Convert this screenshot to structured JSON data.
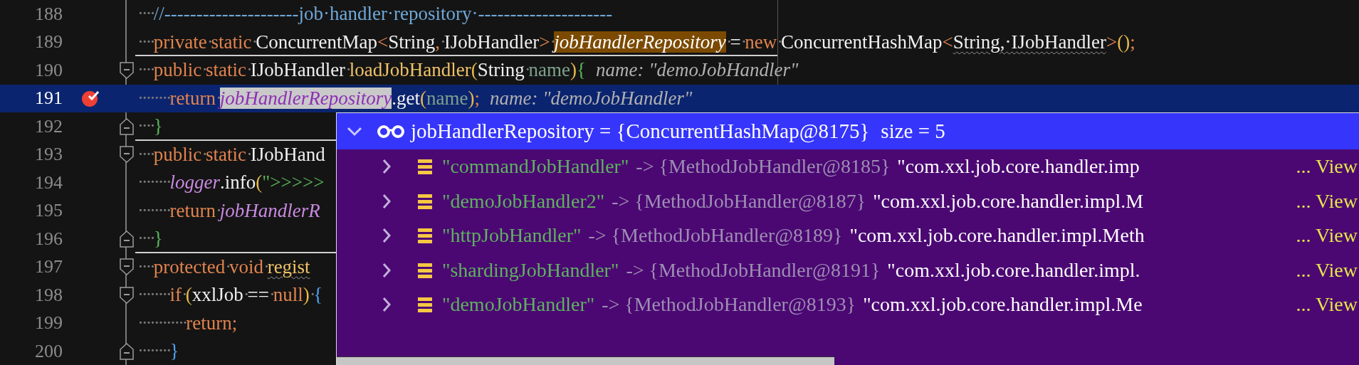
{
  "editor": {
    "lines": [
      {
        "number": "188",
        "current": false,
        "breakpoint": false,
        "fold_start": false,
        "fold_end": false,
        "separator": false,
        "tokens": [
          {
            "text": "····",
            "kind": "ws"
          },
          {
            "text": "//---------------------job·handler·repository·---------------------",
            "kind": "comment"
          }
        ]
      },
      {
        "number": "189",
        "current": false,
        "breakpoint": false,
        "fold_start": false,
        "fold_end": false,
        "separator": true,
        "tokens": [
          {
            "text": "····",
            "kind": "ws"
          },
          {
            "text": "private",
            "kind": "kw"
          },
          {
            "text": "·",
            "kind": "ws"
          },
          {
            "text": "static",
            "kind": "kw"
          },
          {
            "text": "·",
            "kind": "ws"
          },
          {
            "text": "ConcurrentMap",
            "kind": "plain"
          },
          {
            "text": "<",
            "kind": "op"
          },
          {
            "text": "String",
            "kind": "plain"
          },
          {
            "text": ",",
            "kind": "op"
          },
          {
            "text": "·",
            "kind": "ws"
          },
          {
            "text": "IJobHandler",
            "kind": "plain"
          },
          {
            "text": ">",
            "kind": "op"
          },
          {
            "text": "·",
            "kind": "ws"
          },
          {
            "text": "jobHandlerRepository",
            "kind": "fieldhl"
          },
          {
            "text": "·",
            "kind": "ws"
          },
          {
            "text": "=",
            "kind": "plain"
          },
          {
            "text": "·",
            "kind": "ws"
          },
          {
            "text": "new",
            "kind": "kw"
          },
          {
            "text": "·",
            "kind": "ws"
          },
          {
            "text": "ConcurrentHashMap",
            "kind": "plain"
          },
          {
            "text": "<",
            "kind": "op"
          },
          {
            "text": "String,·IJobHandler",
            "kind": "warn"
          },
          {
            "text": ">",
            "kind": "op"
          },
          {
            "text": "()",
            "kind": "paren"
          },
          {
            "text": ";",
            "kind": "op"
          }
        ]
      },
      {
        "number": "190",
        "current": false,
        "breakpoint": false,
        "fold_start": true,
        "fold_end": false,
        "separator": false,
        "tokens": [
          {
            "text": "····",
            "kind": "ws"
          },
          {
            "text": "public",
            "kind": "kw"
          },
          {
            "text": "·",
            "kind": "ws"
          },
          {
            "text": "static",
            "kind": "kw"
          },
          {
            "text": "·",
            "kind": "ws"
          },
          {
            "text": "IJobHandler",
            "kind": "plain"
          },
          {
            "text": "·",
            "kind": "ws"
          },
          {
            "text": "loadJobHandler",
            "kind": "method"
          },
          {
            "text": "(",
            "kind": "paren"
          },
          {
            "text": "String",
            "kind": "plain"
          },
          {
            "text": "·",
            "kind": "ws"
          },
          {
            "text": "name",
            "kind": "param"
          },
          {
            "text": ")",
            "kind": "paren"
          },
          {
            "text": "{",
            "kind": "brace"
          }
        ],
        "hint": "name: \"demoJobHandler\""
      },
      {
        "number": "191",
        "current": true,
        "breakpoint": true,
        "fold_start": false,
        "fold_end": false,
        "separator": false,
        "tokens": [
          {
            "text": "········",
            "kind": "ws"
          },
          {
            "text": "return",
            "kind": "kw"
          },
          {
            "text": "·",
            "kind": "ws"
          },
          {
            "text": "jobHandlerRepository",
            "kind": "fieldsel"
          },
          {
            "text": ".get",
            "kind": "plain"
          },
          {
            "text": "(",
            "kind": "paren"
          },
          {
            "text": "name",
            "kind": "param"
          },
          {
            "text": ")",
            "kind": "paren"
          },
          {
            "text": ";",
            "kind": "op"
          }
        ],
        "hint": "name: \"demoJobHandler\""
      },
      {
        "number": "192",
        "current": false,
        "breakpoint": false,
        "fold_start": false,
        "fold_end": true,
        "separator": true,
        "tokens": [
          {
            "text": "····",
            "kind": "ws"
          },
          {
            "text": "}",
            "kind": "brace"
          }
        ]
      },
      {
        "number": "193",
        "current": false,
        "breakpoint": false,
        "fold_start": true,
        "fold_end": false,
        "separator": false,
        "tokens": [
          {
            "text": "····",
            "kind": "ws"
          },
          {
            "text": "public",
            "kind": "kw"
          },
          {
            "text": "·",
            "kind": "ws"
          },
          {
            "text": "static",
            "kind": "kw"
          },
          {
            "text": "·",
            "kind": "ws"
          },
          {
            "text": "IJobHand",
            "kind": "plain"
          }
        ]
      },
      {
        "number": "194",
        "current": false,
        "breakpoint": false,
        "fold_start": false,
        "fold_end": false,
        "separator": false,
        "tokens": [
          {
            "text": "········",
            "kind": "ws"
          },
          {
            "text": "logger",
            "kind": "field"
          },
          {
            "text": ".info",
            "kind": "plain"
          },
          {
            "text": "(",
            "kind": "paren"
          },
          {
            "text": "\">>>>>",
            "kind": "string"
          }
        ]
      },
      {
        "number": "195",
        "current": false,
        "breakpoint": false,
        "fold_start": false,
        "fold_end": false,
        "separator": false,
        "tokens": [
          {
            "text": "········",
            "kind": "ws"
          },
          {
            "text": "return",
            "kind": "kw"
          },
          {
            "text": "·",
            "kind": "ws"
          },
          {
            "text": "jobHandlerR",
            "kind": "field"
          }
        ]
      },
      {
        "number": "196",
        "current": false,
        "breakpoint": false,
        "fold_start": false,
        "fold_end": true,
        "separator": true,
        "tokens": [
          {
            "text": "····",
            "kind": "ws"
          },
          {
            "text": "}",
            "kind": "brace"
          }
        ]
      },
      {
        "number": "197",
        "current": false,
        "breakpoint": false,
        "fold_start": true,
        "fold_end": false,
        "separator": false,
        "tokens": [
          {
            "text": "····",
            "kind": "ws"
          },
          {
            "text": "protected",
            "kind": "kw"
          },
          {
            "text": "·",
            "kind": "ws"
          },
          {
            "text": "void",
            "kind": "kw"
          },
          {
            "text": "·",
            "kind": "ws"
          },
          {
            "text": "regist",
            "kind": "warnmethod"
          }
        ]
      },
      {
        "number": "198",
        "current": false,
        "breakpoint": false,
        "fold_start": true,
        "fold_end": false,
        "separator": false,
        "tokens": [
          {
            "text": "········",
            "kind": "ws"
          },
          {
            "text": "if",
            "kind": "kw"
          },
          {
            "text": "·",
            "kind": "ws"
          },
          {
            "text": "(",
            "kind": "paren"
          },
          {
            "text": "xxlJob",
            "kind": "plain"
          },
          {
            "text": "·",
            "kind": "ws"
          },
          {
            "text": "==",
            "kind": "plain"
          },
          {
            "text": "·",
            "kind": "ws"
          },
          {
            "text": "null",
            "kind": "kw"
          },
          {
            "text": ")",
            "kind": "paren"
          },
          {
            "text": "·",
            "kind": "ws"
          },
          {
            "text": "{",
            "kind": "block"
          }
        ]
      },
      {
        "number": "199",
        "current": false,
        "breakpoint": false,
        "fold_start": false,
        "fold_end": false,
        "separator": false,
        "tokens": [
          {
            "text": "············",
            "kind": "ws"
          },
          {
            "text": "return;",
            "kind": "kw"
          }
        ]
      },
      {
        "number": "200",
        "current": false,
        "breakpoint": false,
        "fold_start": false,
        "fold_end": true,
        "separator": false,
        "tokens": [
          {
            "text": "········",
            "kind": "ws"
          },
          {
            "text": "}",
            "kind": "block"
          }
        ]
      }
    ]
  },
  "popup": {
    "expanded": true,
    "title": "jobHandlerRepository = {ConcurrentHashMap@8175}",
    "size": "size = 5",
    "entries": [
      {
        "expanded": false,
        "key": "\"commandJobHandler\"",
        "value": "-> {MethodJobHandler@8185}",
        "preview": "\"com.xxl.job.core.handler.imp",
        "link": "... View"
      },
      {
        "expanded": false,
        "key": "\"demoJobHandler2\"",
        "value": "-> {MethodJobHandler@8187}",
        "preview": "\"com.xxl.job.core.handler.impl.M",
        "link": "... View"
      },
      {
        "expanded": false,
        "key": "\"httpJobHandler\"",
        "value": "-> {MethodJobHandler@8189}",
        "preview": "\"com.xxl.job.core.handler.impl.Meth",
        "link": "... View"
      },
      {
        "expanded": false,
        "key": "\"shardingJobHandler\"",
        "value": "-> {MethodJobHandler@8191}",
        "preview": "\"com.xxl.job.core.handler.impl.",
        "link": "... View"
      },
      {
        "expanded": false,
        "key": "\"demoJobHandler\"",
        "value": "-> {MethodJobHandler@8193}",
        "preview": "\"com.xxl.job.core.handler.impl.Me",
        "link": "... View"
      }
    ]
  }
}
